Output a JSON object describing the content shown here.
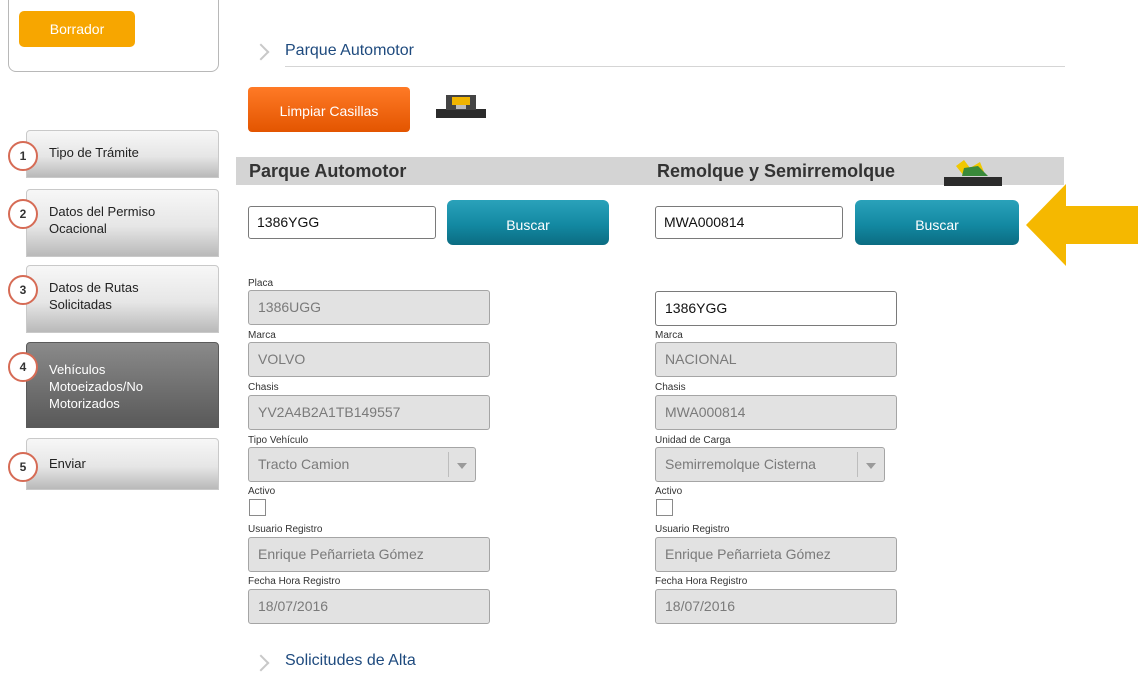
{
  "status": {
    "label": "Borrador",
    "color": "#f7a600"
  },
  "steps": [
    {
      "num": "1",
      "label": "Tipo de Trámite",
      "active": false
    },
    {
      "num": "2",
      "label": "Datos del Permiso Ocacional",
      "active": false
    },
    {
      "num": "3",
      "label": "Datos de Rutas Solicitadas",
      "active": false
    },
    {
      "num": "4",
      "label": "Vehículos Motoeizados/No Motorizados",
      "active": true
    },
    {
      "num": "5",
      "label": "Enviar",
      "active": false
    }
  ],
  "section_title": "Parque Automotor",
  "clear_button": "Limpiar Casillas",
  "icons": {
    "save": "save-icon",
    "trailer": "trailer-icon",
    "pointer": "arrow-pointer"
  },
  "left": {
    "title": "Parque Automotor",
    "search_value": "1386YGG",
    "search_button": "Buscar",
    "fields": {
      "placa_label": "Placa",
      "placa": "1386UGG",
      "marca_label": "Marca",
      "marca": "VOLVO",
      "chasis_label": "Chasis",
      "chasis": "YV2A4B2A1TB149557",
      "tipo_label": "Tipo Vehículo",
      "tipo": "Tracto Camion",
      "activo_label": "Activo",
      "usuario_label": "Usuario Registro",
      "usuario": "Enrique Peñarrieta Gómez",
      "fecha_label": "Fecha Hora Registro",
      "fecha": "18/07/2016"
    }
  },
  "right": {
    "title": "Remolque y Semirremolque",
    "search_value": "MWA000814",
    "search_button": "Buscar",
    "fields": {
      "placa": "1386YGG",
      "marca_label": "Marca",
      "marca": "NACIONAL",
      "chasis_label": "Chasis",
      "chasis": "MWA000814",
      "unidad_label": "Unidad de Carga",
      "unidad": "Semirremolque Cisterna",
      "activo_label": "Activo",
      "usuario_label": "Usuario Registro",
      "usuario": "Enrique Peñarrieta Gómez",
      "fecha_label": "Fecha Hora Registro",
      "fecha": "18/07/2016"
    }
  },
  "next_section": "Solicitudes de Alta",
  "colors": {
    "accent_orange": "#f26b10",
    "button_teal": "#1a8ea6",
    "arrow": "#f5b800",
    "link_blue": "#1e4a7e"
  }
}
